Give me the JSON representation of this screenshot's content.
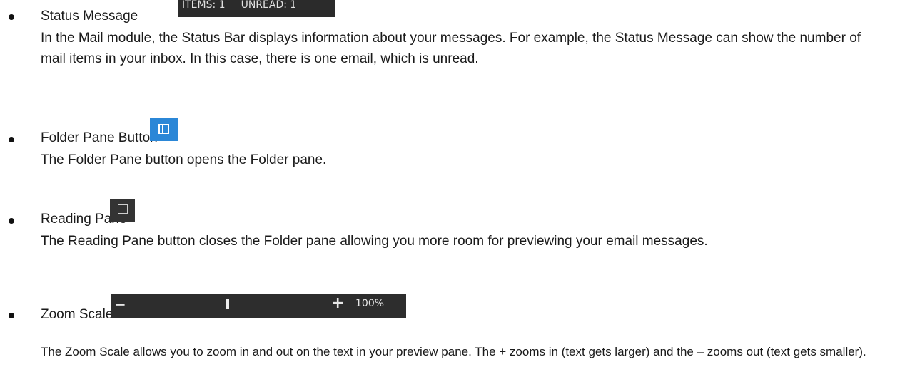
{
  "status_message": {
    "title": "Status Message",
    "statusbar": {
      "items": "ITEMS: 1",
      "unread": "UNREAD: 1"
    },
    "description": "In the Mail module, the Status Bar displays information about your messages. For example, the Status Message can show the number of mail items in your inbox. In this case, there is one email, which is unread."
  },
  "folder_pane": {
    "title": "Folder Pane Button",
    "description": "The Folder Pane button opens the Folder pane.",
    "icon": "folder-pane-icon",
    "color": "#2b87d7"
  },
  "reading_pane": {
    "title": "Reading Pane",
    "description": "The Reading Pane button closes the Folder pane allowing you more room for previewing your email messages.",
    "icon": "book-icon"
  },
  "zoom_scale": {
    "title": "Zoom Scale",
    "minus": "−",
    "plus": "+",
    "percent_label": "100%",
    "slider_position_fraction": 0.5,
    "description": "The Zoom Scale allows you to zoom in and out on the text in your preview pane. The + zooms in (text gets larger) and the – zooms out (text gets smaller)."
  }
}
